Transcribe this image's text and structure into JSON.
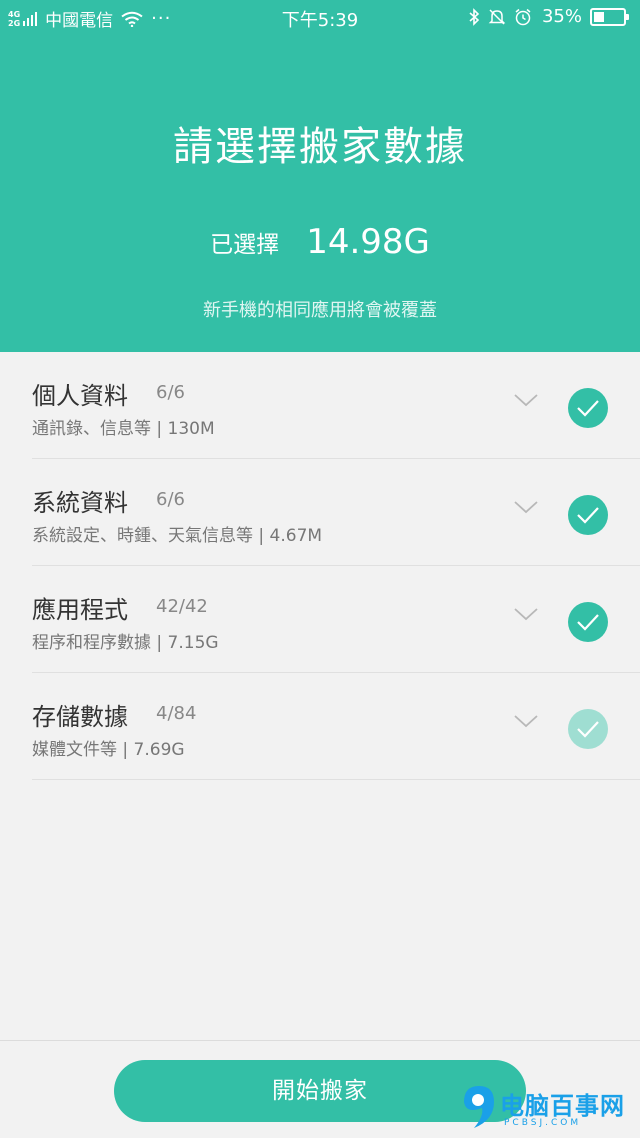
{
  "status_bar": {
    "network_top": "4G",
    "network_bottom": "2G",
    "carrier": "中國電信",
    "more": "···",
    "time": "下午5:39",
    "battery_percent": "35%",
    "battery_level": 0.35
  },
  "header": {
    "title": "請選擇搬家數據",
    "selected_label": "已選擇",
    "selected_value": "14.98G",
    "warning": "新手機的相同應用將會被覆蓋"
  },
  "items": [
    {
      "title": "個人資料",
      "count": "6/6",
      "description": "通訊錄、信息等 | 130M",
      "state": "checked"
    },
    {
      "title": "系統資料",
      "count": "6/6",
      "description": "系統設定、時鍾、天氣信息等 | 4.67M",
      "state": "checked"
    },
    {
      "title": "應用程式",
      "count": "42/42",
      "description": "程序和程序數據 | 7.15G",
      "state": "checked"
    },
    {
      "title": "存儲數據",
      "count": "4/84",
      "description": "媒體文件等 | 7.69G",
      "state": "partial"
    }
  ],
  "bottom": {
    "start_button": "開始搬家"
  },
  "watermark": {
    "text": "电脑百事网",
    "url": "PCBSJ.COM"
  },
  "colors": {
    "accent": "#33bfa6",
    "accent_light": "#9fded2",
    "background": "#f2f2f2"
  }
}
